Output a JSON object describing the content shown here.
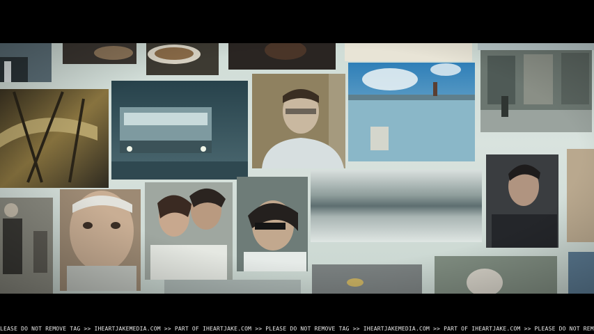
{
  "watermark": {
    "text": "LEASE DO NOT REMOVE TAG >> IHEARTJAKEMEDIA.COM >> PART OF IHEARTJAKE.COM >> PLEASE DO NOT REMOVE TAG >> IHEARTJAKEMEDIA.COM >> PART OF IHEARTJAKE.COM >> PLEASE DO NOT REMOVE TAG >> IHEARTJAKEMEDIA.COM"
  },
  "photos": [
    {
      "name": "photo-partial-man-suit",
      "color": "#5c6f78"
    },
    {
      "name": "photo-food-dish-dark",
      "color": "#3a3530"
    },
    {
      "name": "photo-food-plate",
      "color": "#6b5a44"
    },
    {
      "name": "photo-dark-hair",
      "color": "#2a2522"
    },
    {
      "name": "photo-pale-top",
      "color": "#e8e4d6"
    },
    {
      "name": "photo-sky-strip",
      "color": "#b8c7c8"
    },
    {
      "name": "photo-gold-instrument",
      "color": "#6b5a30"
    },
    {
      "name": "photo-streetcar-night",
      "color": "#3e5a64"
    },
    {
      "name": "photo-man-glasses",
      "color": "#a59a7e"
    },
    {
      "name": "photo-blue-building-sky",
      "color": "#5a90b0"
    },
    {
      "name": "photo-graffiti-wall",
      "color": "#6b7670"
    },
    {
      "name": "photo-old-man-portrait",
      "color": "#8a8a80"
    },
    {
      "name": "photo-elderly-man-closeup",
      "color": "#9d8a74"
    },
    {
      "name": "photo-couple-kiss",
      "color": "#9fa7a0"
    },
    {
      "name": "photo-woman-sunglasses",
      "color": "#6e7c78"
    },
    {
      "name": "photo-motion-blur",
      "color": "#9aa4a2"
    },
    {
      "name": "photo-man-dark-sweater",
      "color": "#3a3d40"
    },
    {
      "name": "photo-edge-right",
      "color": "#b9a88e"
    },
    {
      "name": "photo-bottom-grey",
      "color": "#7a8080"
    },
    {
      "name": "photo-bottom-crowd",
      "color": "#7f8c80"
    },
    {
      "name": "photo-bottom-edge",
      "color": "#5b7a92"
    }
  ]
}
